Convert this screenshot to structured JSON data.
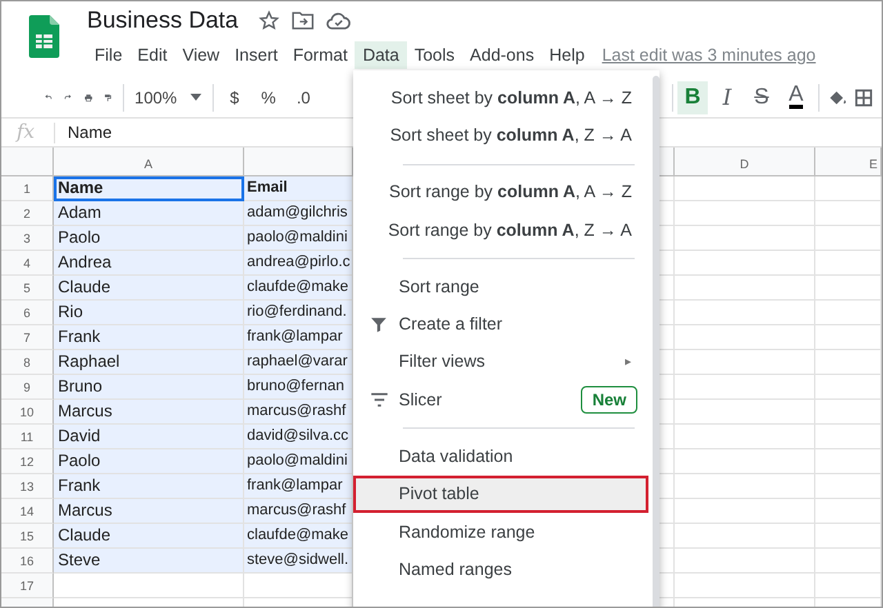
{
  "document": {
    "title": "Business Data",
    "last_edit": "Last edit was 3 minutes ago"
  },
  "menubar": [
    {
      "label": "File",
      "selected": false
    },
    {
      "label": "Edit",
      "selected": false
    },
    {
      "label": "View",
      "selected": false
    },
    {
      "label": "Insert",
      "selected": false
    },
    {
      "label": "Format",
      "selected": false
    },
    {
      "label": "Data",
      "selected": true
    },
    {
      "label": "Tools",
      "selected": false
    },
    {
      "label": "Add-ons",
      "selected": false
    },
    {
      "label": "Help",
      "selected": false
    }
  ],
  "toolbar": {
    "zoom": "100%",
    "currency": "$",
    "percent": "%",
    "decimal": ".0",
    "format_buttons": [
      {
        "kind": "bold",
        "label": "B",
        "selected": true
      },
      {
        "kind": "italic",
        "label": "I",
        "selected": false
      },
      {
        "kind": "strike",
        "label": "S",
        "selected": false
      },
      {
        "kind": "color",
        "label": "A",
        "selected": false
      }
    ]
  },
  "formula_bar": {
    "label": "fx",
    "value": "Name"
  },
  "grid": {
    "column_headers": [
      "A",
      "D",
      "E"
    ],
    "rows": [
      {
        "number": "1",
        "name": "Name",
        "email": "Email",
        "header": true,
        "selected": true
      },
      {
        "number": "2",
        "name": "Adam",
        "email": "adam@gilchris",
        "header": false,
        "selected": true
      },
      {
        "number": "3",
        "name": "Paolo",
        "email": "paolo@maldini",
        "header": false,
        "selected": true
      },
      {
        "number": "4",
        "name": "Andrea",
        "email": "andrea@pirlo.c",
        "header": false,
        "selected": true
      },
      {
        "number": "5",
        "name": "Claude",
        "email": "claufde@make",
        "header": false,
        "selected": true
      },
      {
        "number": "6",
        "name": "Rio",
        "email": "rio@ferdinand.",
        "header": false,
        "selected": true
      },
      {
        "number": "7",
        "name": "Frank",
        "email": "frank@lampar",
        "header": false,
        "selected": true
      },
      {
        "number": "8",
        "name": "Raphael",
        "email": "raphael@varar",
        "header": false,
        "selected": true
      },
      {
        "number": "9",
        "name": "Bruno",
        "email": "bruno@fernan",
        "header": false,
        "selected": true
      },
      {
        "number": "10",
        "name": "Marcus",
        "email": "marcus@rashf",
        "header": false,
        "selected": true
      },
      {
        "number": "11",
        "name": "David",
        "email": "david@silva.cc",
        "header": false,
        "selected": true
      },
      {
        "number": "12",
        "name": "Paolo",
        "email": "paolo@maldini",
        "header": false,
        "selected": true
      },
      {
        "number": "13",
        "name": "Frank",
        "email": "frank@lampar",
        "header": false,
        "selected": true
      },
      {
        "number": "14",
        "name": "Marcus",
        "email": "marcus@rashf",
        "header": false,
        "selected": true
      },
      {
        "number": "15",
        "name": "Claude",
        "email": "claufde@make",
        "header": false,
        "selected": true
      },
      {
        "number": "16",
        "name": "Steve",
        "email": "steve@sidwell.",
        "header": false,
        "selected": true
      },
      {
        "number": "17",
        "selected": false
      }
    ]
  },
  "data_menu": [
    {
      "kind": "item",
      "label": "Sort sheet by **column A**, A → Z",
      "highlighted": false
    },
    {
      "kind": "item",
      "label": "Sort sheet by **column A**, Z → A",
      "highlighted": false
    },
    {
      "kind": "separator"
    },
    {
      "kind": "item",
      "label": "Sort range by **column A**, A → Z",
      "highlighted": false
    },
    {
      "kind": "item",
      "label": "Sort range by **column A**, Z → A",
      "highlighted": false
    },
    {
      "kind": "separator"
    },
    {
      "kind": "item",
      "label": "Sort range",
      "highlighted": false
    },
    {
      "kind": "filter",
      "label": "Create a filter",
      "highlighted": false
    },
    {
      "kind": "submenu",
      "label": "Filter views",
      "arrow": "▸",
      "highlighted": false
    },
    {
      "kind": "slicer",
      "label": "Slicer",
      "badge": "New",
      "highlighted": false
    },
    {
      "kind": "separator"
    },
    {
      "kind": "item",
      "label": "Data validation",
      "highlighted": false
    },
    {
      "kind": "item",
      "label": "Pivot table",
      "highlighted": true
    },
    {
      "kind": "item",
      "label": "Randomize range",
      "highlighted": false
    },
    {
      "kind": "item",
      "label": "Named ranges",
      "highlighted": false
    }
  ]
}
